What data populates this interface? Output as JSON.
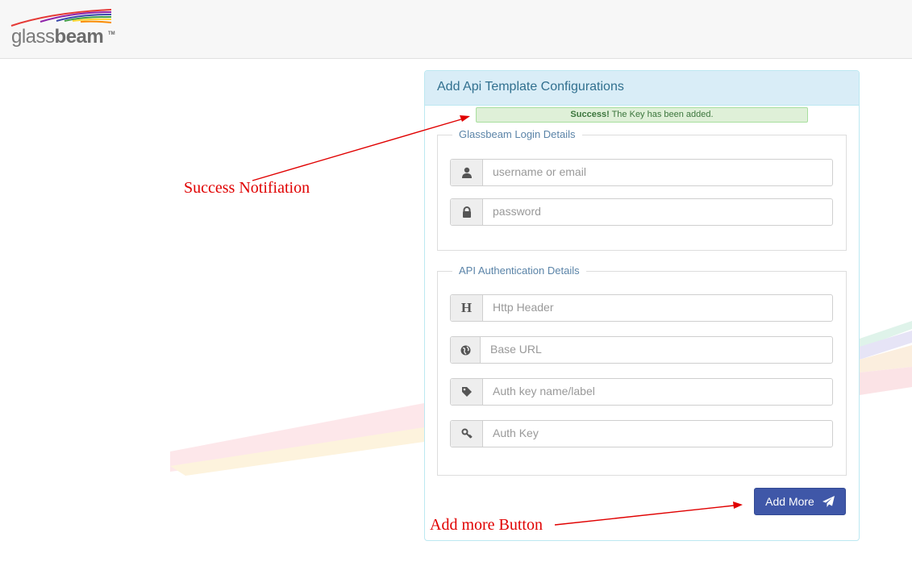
{
  "brand": {
    "logo_main": "glass",
    "logo_bold": "beam",
    "logo_tm": "TM"
  },
  "panel": {
    "title": "Add Api Template Configurations",
    "alert": {
      "strong": "Success!",
      "text": " The Key has been added."
    }
  },
  "login": {
    "legend": "Glassbeam Login Details",
    "username_placeholder": "username or email",
    "password_placeholder": "password"
  },
  "api": {
    "legend": "API Authentication Details",
    "header_icon": "H",
    "header_placeholder": "Http Header",
    "base_url_placeholder": "Base URL",
    "auth_label_placeholder": "Auth key name/label",
    "auth_key_placeholder": "Auth Key"
  },
  "actions": {
    "add_more_label": "Add More"
  },
  "annotations": {
    "success": "Success Notifiation",
    "add_more": "Add more Button"
  },
  "icons": {
    "username": "user-icon",
    "password": "lock-icon",
    "header": "header-h-icon",
    "base_url": "globe-icon",
    "auth_label": "tag-icon",
    "auth_key": "key-icon",
    "add_more": "paper-plane-icon"
  },
  "colors": {
    "panel_heading_bg": "#d9edf7",
    "panel_heading_text": "#31708f",
    "alert_bg": "#dff0d8",
    "button_bg": "#3f57a8",
    "annotation": "#e00000"
  }
}
